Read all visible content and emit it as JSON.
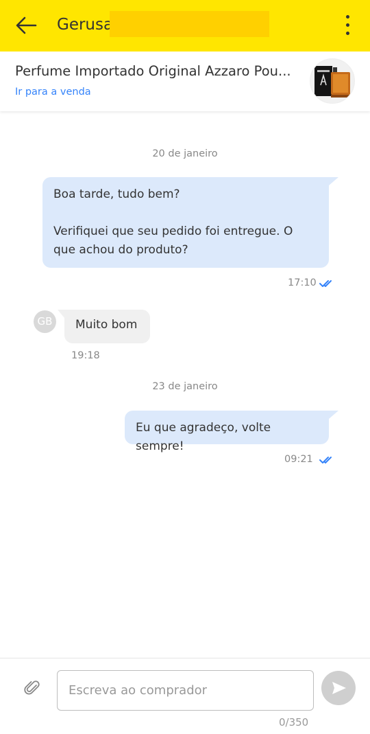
{
  "header": {
    "back_icon": "arrow-left-icon",
    "contact_name": "Gerusa",
    "menu_icon": "more-vertical-icon",
    "background_color": "#ffe600"
  },
  "product": {
    "title": "Perfume Importado Original Azzaro Pou...",
    "link_label": "Ir para a venda",
    "link_color": "#3483fa",
    "thumbnail_icon": "product-thumbnail"
  },
  "chat": {
    "date_1": "20 de janeiro",
    "msg_1_line_1": "Boa tarde, tudo bem?",
    "msg_1_line_2": "Verifiquei que seu pedido foi entregue. O que achou do produto?",
    "msg_1_time": "17:10",
    "avatar_initials": "GB",
    "msg_2_text": "Muito bom",
    "msg_2_time": "19:18",
    "date_2": "23 de janeiro",
    "msg_3_text": "Eu que agradeço, volte sempre!",
    "msg_3_time": "09:21",
    "read_icon": "double-check-icon",
    "outgoing_bubble_color": "#dce9fb",
    "incoming_bubble_color": "#f0f0f0"
  },
  "composer": {
    "attach_icon": "paperclip-icon",
    "placeholder": "Escreva ao comprador",
    "send_icon": "send-icon",
    "counter": "0/350"
  }
}
